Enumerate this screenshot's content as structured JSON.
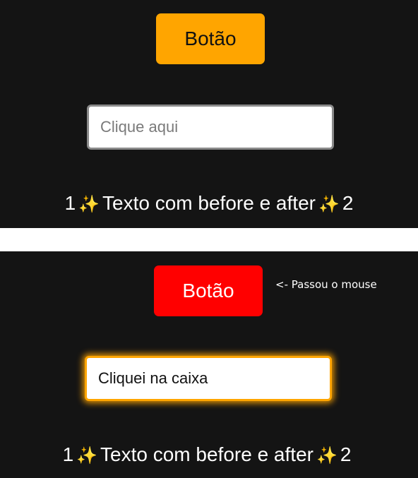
{
  "states": {
    "normal": {
      "button_label": "Botão",
      "input_placeholder": "Clique aqui",
      "input_value": "",
      "text": {
        "before": "1",
        "before_icon": "✨",
        "main": "Texto com before e after",
        "after_icon": "✨",
        "after": "2"
      }
    },
    "interacted": {
      "button_label": "Botão",
      "hover_note": "<- Passou o mouse",
      "input_placeholder": "",
      "input_value": "Cliquei na caixa",
      "text": {
        "before": "1",
        "before_icon": "✨",
        "main": "Texto com before e after",
        "after_icon": "✨",
        "after": "2"
      }
    }
  },
  "colors": {
    "background": "#141414",
    "separator": "#ffffff",
    "button_normal": "#ffa500",
    "button_hover": "#ff0000",
    "input_focus_border": "#ffa500",
    "input_normal_border": "#8a8a8a"
  }
}
